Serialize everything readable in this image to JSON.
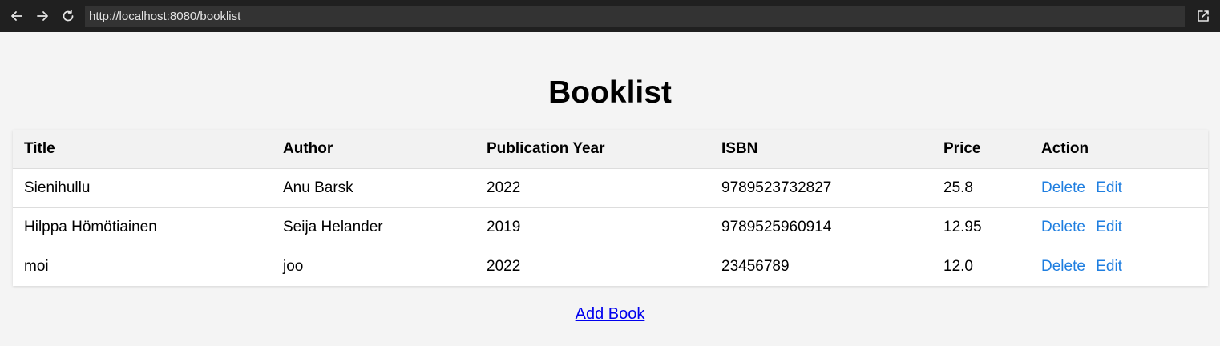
{
  "browser": {
    "url": "http://localhost:8080/booklist"
  },
  "page": {
    "title": "Booklist",
    "add_book_label": "Add Book"
  },
  "table": {
    "headers": [
      "Title",
      "Author",
      "Publication Year",
      "ISBN",
      "Price",
      "Action"
    ],
    "rows": [
      {
        "title": "Sienihullu",
        "author": "Anu Barsk",
        "year": "2022",
        "isbn": "9789523732827",
        "price": "25.8"
      },
      {
        "title": "Hilppa Hömötiainen",
        "author": "Seija Helander",
        "year": "2019",
        "isbn": "9789525960914",
        "price": "12.95"
      },
      {
        "title": "moi",
        "author": "joo",
        "year": "2022",
        "isbn": "23456789",
        "price": "12.0"
      }
    ],
    "actions": {
      "delete_label": "Delete",
      "edit_label": "Edit"
    }
  },
  "colors": {
    "browser_bar": "#202020",
    "url_bar": "#333333",
    "page_background": "#f4f4f4",
    "action_link": "#1e7ee0",
    "add_link": "#0000ee"
  }
}
